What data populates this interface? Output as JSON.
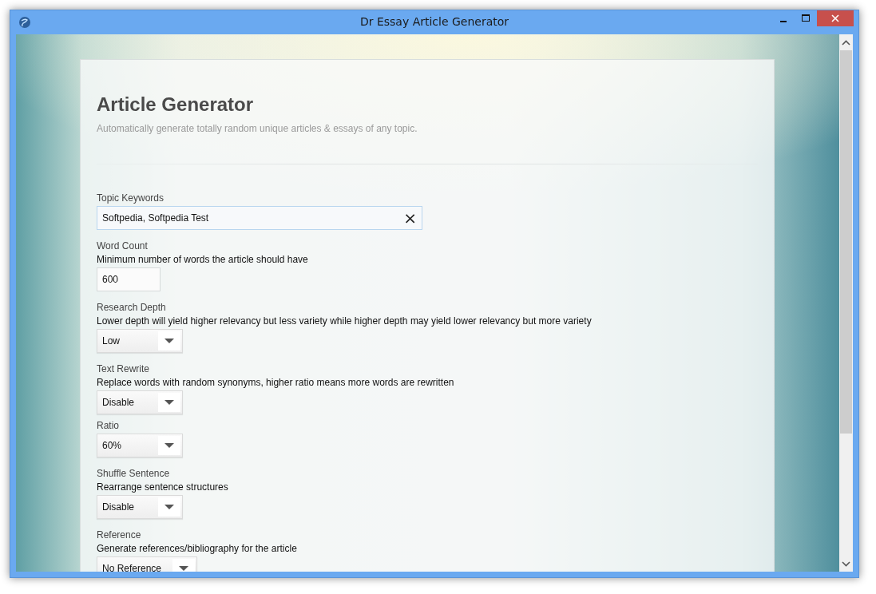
{
  "window": {
    "title": "Dr Essay Article Generator"
  },
  "heading": "Article Generator",
  "subtitle": "Automatically generate totally random unique articles & essays of any topic.",
  "fields": [
    {
      "kind": "text",
      "label": "Topic Keywords",
      "value": "Softpedia, Softpedia Test",
      "clear": "×"
    },
    {
      "kind": "number",
      "label": "Word Count",
      "description": "Minimum number of words the article should have",
      "value": "600"
    },
    {
      "kind": "select",
      "label": "Research Depth",
      "description": "Lower depth will yield higher relevancy but less variety while higher depth may yield lower relevancy but more variety",
      "value": "Low"
    },
    {
      "kind": "select",
      "label": "Text Rewrite",
      "description": "Replace words with random synonyms, higher ratio means more words are rewritten",
      "value": "Disable",
      "children": [
        {
          "kind": "select",
          "label": "Ratio",
          "value": "60%"
        }
      ]
    },
    {
      "kind": "select",
      "label": "Shuffle Sentence",
      "description": "Rearrange sentence structures",
      "value": "Disable"
    },
    {
      "kind": "select",
      "label": "Reference",
      "description": "Generate references/bibliography for the article",
      "value": "No Reference"
    }
  ]
}
